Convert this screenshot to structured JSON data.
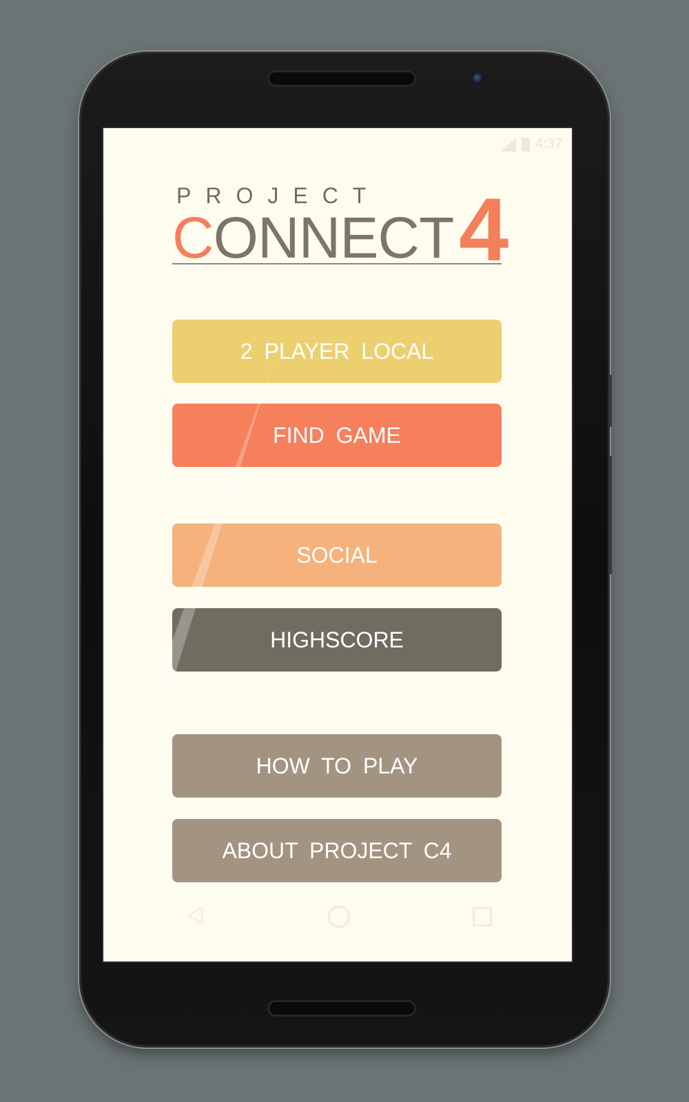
{
  "status_bar": {
    "time": "4:37"
  },
  "logo": {
    "top_word": "PROJECT",
    "main_word_accent": "C",
    "main_word_rest": "ONNECT",
    "number": "4"
  },
  "menu": {
    "two_player_local": "2 PLAYER LOCAL",
    "find_game": "FIND GAME",
    "social": "SOCIAL",
    "highscore": "HIGHSCORE",
    "how_to_play": "HOW TO PLAY",
    "about": "ABOUT PROJECT C4"
  },
  "colors": {
    "background": "#fefcef",
    "accent": "#f47f5b",
    "yellow": "#ecd070",
    "orange": "#f67f5c",
    "peach": "#f5b27c",
    "dark": "#6f6c60",
    "taupe": "#a39482"
  },
  "icons": {
    "signal": "signal-icon",
    "battery": "battery-icon",
    "back": "nav-back-icon",
    "home": "nav-home-icon",
    "recents": "nav-recents-icon"
  }
}
